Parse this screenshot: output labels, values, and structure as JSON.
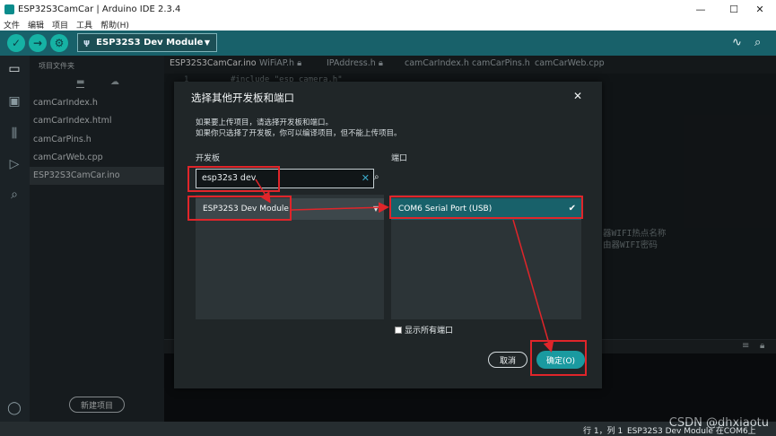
{
  "window": {
    "title": "ESP32S3CamCar | Arduino IDE 2.3.4",
    "controls": [
      "—",
      "☐",
      "✕"
    ]
  },
  "menu": [
    "文件",
    "编辑",
    "项目",
    "工具",
    "帮助(H)"
  ],
  "toolbar": {
    "board_select": "ESP32S3 Dev Module"
  },
  "sidebar": {
    "title": "项目文件夹",
    "files": [
      "camCarIndex.h",
      "camCarIndex.html",
      "camCarPins.h",
      "camCarWeb.cpp",
      "ESP32S3CamCar.ino"
    ],
    "new_project_label": "新建项目"
  },
  "editor": {
    "tabs": [
      "ESP32S3CamCar.ino",
      "WiFiAP.h",
      "IPAddress.h",
      "camCarIndex.h",
      "camCarPins.h",
      "camCarWeb.cpp"
    ],
    "line_number": "1",
    "code_line": "#include \"esp_camera.h\"",
    "comment_1": "器WIFI热点名称",
    "comment_2": "由器WIFI密码"
  },
  "dialog": {
    "title": "选择其他开发板和端口",
    "close_label": "✕",
    "description_1": "如果要上传项目，请选择开发板和端口。",
    "description_2": "如果你只选择了开发板，你可以编译项目，但不能上传项目。",
    "board_label": "开发板",
    "port_label": "端口",
    "search_value": "esp32s3 dev",
    "board_item": "ESP32S3 Dev Module",
    "port_item": "COM6 Serial Port (USB)",
    "show_all_ports": "显示所有端口",
    "cancel_label": "取消",
    "ok_label": "确定(O)"
  },
  "statusbar": {
    "position": "行 1，列 1",
    "board_port": "ESP32S3 Dev Module 在COM6上",
    "watermark": "CSDN @dhxiaotu"
  },
  "colors": {
    "accent": "#18616a",
    "button": "#1a9aa0",
    "annotation": "#e0252a"
  }
}
